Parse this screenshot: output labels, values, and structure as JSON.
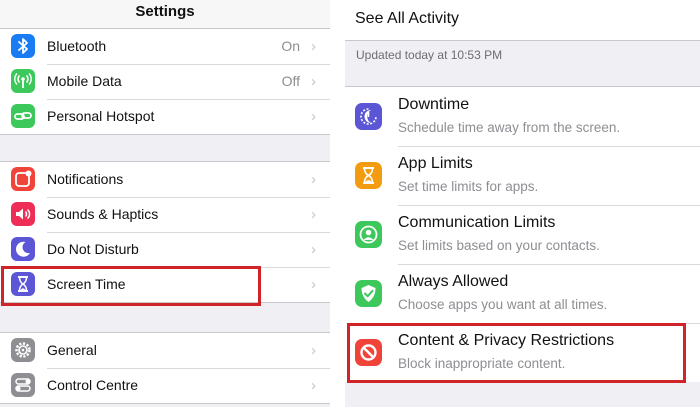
{
  "left": {
    "title": "Settings",
    "group1": [
      {
        "label": "Bluetooth",
        "value": "On",
        "icon": "bluetooth-icon",
        "color": "#1a7cf2"
      },
      {
        "label": "Mobile Data",
        "value": "Off",
        "icon": "antenna-icon",
        "color": "#3cc85a"
      },
      {
        "label": "Personal Hotspot",
        "value": "",
        "icon": "hotspot-icon",
        "color": "#3cc85a"
      }
    ],
    "group2": [
      {
        "label": "Notifications",
        "icon": "notifications-icon",
        "color": "#f0433a"
      },
      {
        "label": "Sounds & Haptics",
        "icon": "speaker-icon",
        "color": "#ee2e57"
      },
      {
        "label": "Do Not Disturb",
        "icon": "moon-icon",
        "color": "#5a56d6"
      },
      {
        "label": "Screen Time",
        "icon": "hourglass-icon",
        "color": "#5a56d6"
      }
    ],
    "group3": [
      {
        "label": "General",
        "icon": "gear-icon",
        "color": "#8e8e93"
      },
      {
        "label": "Control Centre",
        "icon": "toggles-icon",
        "color": "#8e8e93"
      }
    ]
  },
  "right": {
    "header": "See All Activity",
    "updated": "Updated today at 10:53 PM",
    "items": [
      {
        "title": "Downtime",
        "subtitle": "Schedule time away from the screen.",
        "icon": "downtime-icon",
        "color": "#5a56d6"
      },
      {
        "title": "App Limits",
        "subtitle": "Set time limits for apps.",
        "icon": "hourglass-icon",
        "color": "#f39c12"
      },
      {
        "title": "Communication Limits",
        "subtitle": "Set limits based on your contacts.",
        "icon": "contact-icon",
        "color": "#3cc85a"
      },
      {
        "title": "Always Allowed",
        "subtitle": "Choose apps you want at all times.",
        "icon": "check-shield-icon",
        "color": "#3cc85a"
      },
      {
        "title": "Content & Privacy Restrictions",
        "subtitle": "Block inappropriate content.",
        "icon": "restricted-icon",
        "color": "#f0433a"
      }
    ]
  },
  "chevron": "›",
  "highlight_color": "#d1232a"
}
